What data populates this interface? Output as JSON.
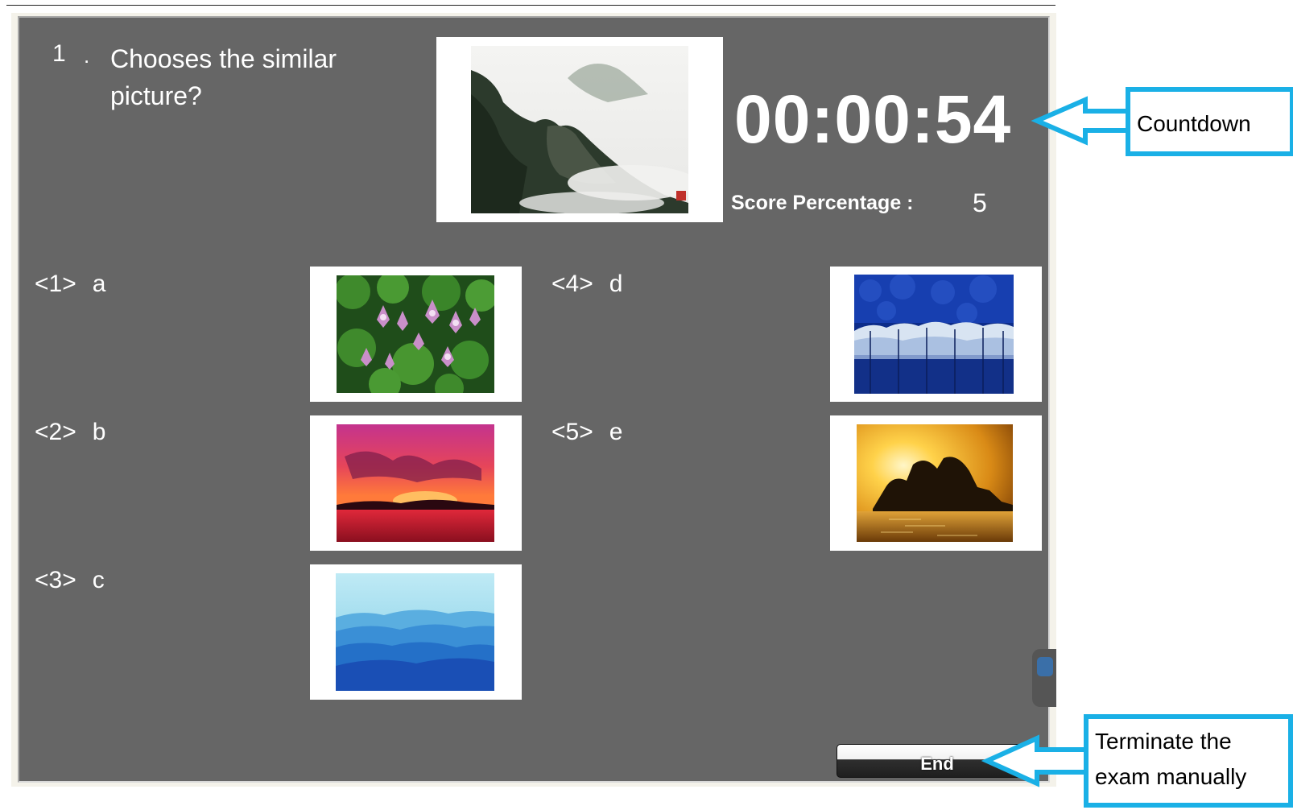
{
  "question": {
    "number": "1",
    "separator": ".",
    "text": "Chooses the similar picture?"
  },
  "timer": {
    "value": "00:00:54"
  },
  "score": {
    "label": "Score Percentage :",
    "value": "5"
  },
  "options": [
    {
      "index": "<1>",
      "letter": "a",
      "image": "lotus-flowers"
    },
    {
      "index": "<2>",
      "letter": "b",
      "image": "red-sunset"
    },
    {
      "index": "<3>",
      "letter": "c",
      "image": "blue-mountains"
    },
    {
      "index": "<4>",
      "letter": "d",
      "image": "frosted-forest"
    },
    {
      "index": "<5>",
      "letter": "e",
      "image": "opera-house-sunset"
    }
  ],
  "end_button": {
    "label": "End"
  },
  "annotations": {
    "countdown": "Countdown",
    "terminate_line1": "Terminate the",
    "terminate_line2": "exam manually"
  },
  "colors": {
    "panel": "#666666",
    "callout_border": "#1ab0e6",
    "text": "#ffffff"
  }
}
